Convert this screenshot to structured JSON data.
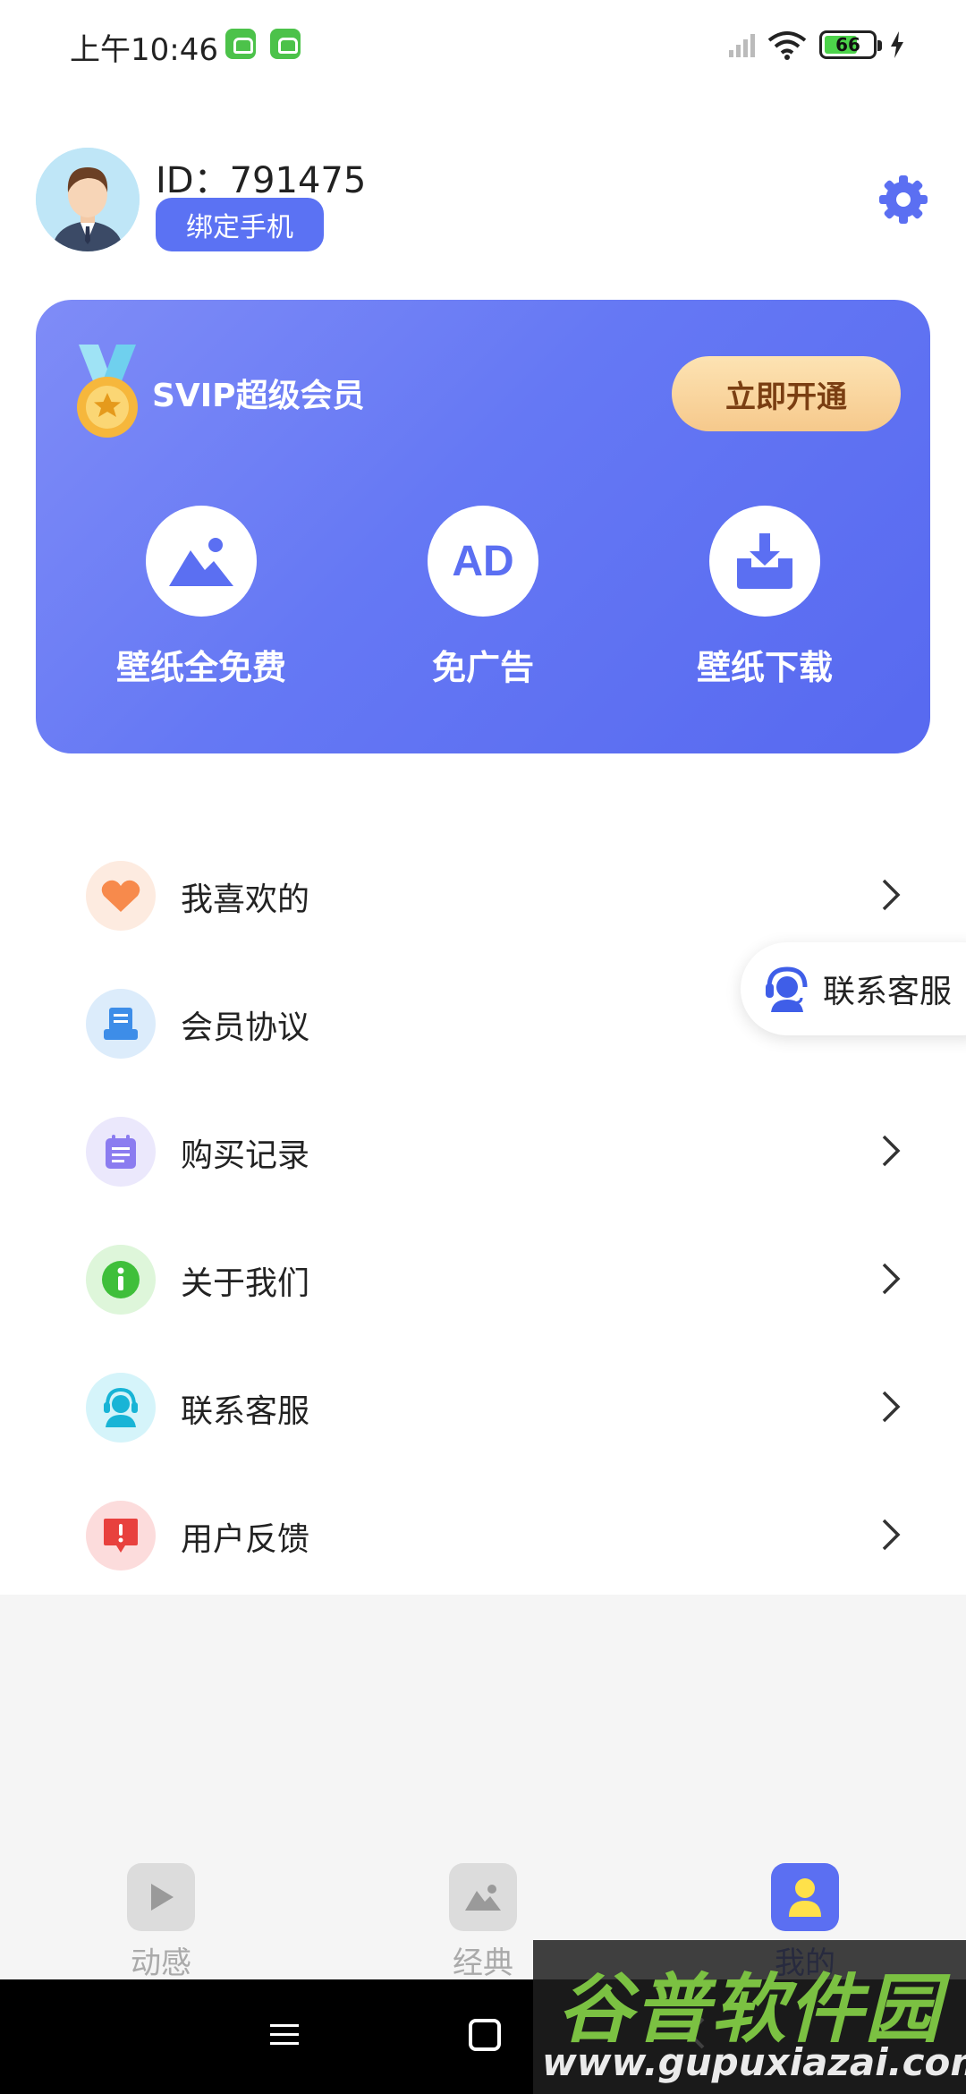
{
  "status_bar": {
    "time": "上午10:46",
    "battery": "66"
  },
  "profile": {
    "id_text": "ID：791475",
    "bind_phone_label": "绑定手机"
  },
  "vip_card": {
    "title": "SVIP超级会员",
    "open_button_label": "立即开通",
    "ad_badge_text": "AD",
    "benefits": [
      {
        "label": "壁纸全免费",
        "icon": "image-icon"
      },
      {
        "label": "免广告",
        "icon": "ad-icon"
      },
      {
        "label": "壁纸下载",
        "icon": "download-icon"
      }
    ]
  },
  "menu": {
    "items": [
      {
        "label": "我喜欢的",
        "icon": "heart-icon"
      },
      {
        "label": "会员协议",
        "icon": "agreement-icon"
      },
      {
        "label": "购买记录",
        "icon": "notepad-icon"
      },
      {
        "label": "关于我们",
        "icon": "info-icon"
      },
      {
        "label": "联系客服",
        "icon": "customer-service-icon"
      },
      {
        "label": "用户反馈",
        "icon": "feedback-icon"
      }
    ]
  },
  "floating_contact": {
    "label": "联系客服"
  },
  "tab_bar": {
    "tabs": [
      {
        "label": "动感",
        "icon": "play-icon",
        "active": false
      },
      {
        "label": "经典",
        "icon": "image-icon",
        "active": false
      },
      {
        "label": "我的",
        "icon": "user-icon",
        "active": true
      }
    ]
  },
  "watermark": {
    "title": "谷普软件园",
    "url": "www.gupuxiazai.com"
  },
  "colors": {
    "primary": "#5b6ff2",
    "vip_button": "#f6c98c",
    "watermark_green": "#7bc142"
  }
}
